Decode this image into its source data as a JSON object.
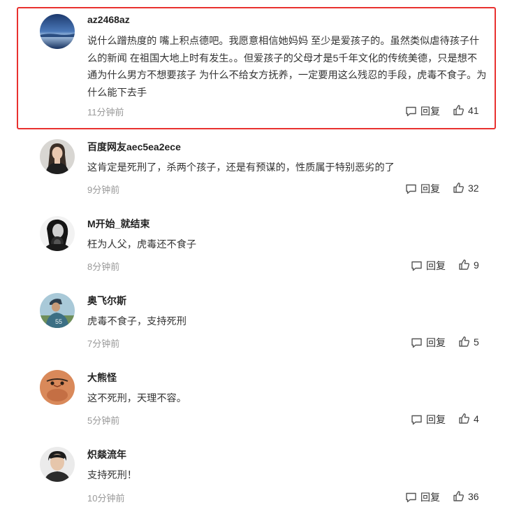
{
  "comments": [
    {
      "username": "az2468az",
      "content": "说什么蹭热度的 嘴上积点德吧。我愿意相信她妈妈 至少是爱孩子的。虽然类似虐待孩子什么的新闻 在祖国大地上时有发生。。但爱孩子的父母才是5千年文化的传统美德，只是想不通为什么男方不想要孩子 为什么不给女方抚养，一定要用这么残忍的手段，虎毒不食子。为什么能下去手",
      "time": "11分钟前",
      "reply_label": "回复",
      "likes": "41",
      "highlighted": true
    },
    {
      "username": "百度网友aec5ea2ece",
      "content": "这肯定是死刑了，杀两个孩子，还是有预谋的，性质属于特别恶劣的了",
      "time": "9分钟前",
      "reply_label": "回复",
      "likes": "32"
    },
    {
      "username": "M开始_就结束",
      "content": "枉为人父，虎毒还不食子",
      "time": "8分钟前",
      "reply_label": "回复",
      "likes": "9"
    },
    {
      "username": "奥飞尔斯",
      "content": "虎毒不食子，支持死刑",
      "time": "7分钟前",
      "reply_label": "回复",
      "likes": "5"
    },
    {
      "username": "大熊怪",
      "content": "这不死刑，天理不容。",
      "time": "5分钟前",
      "reply_label": "回复",
      "likes": "4"
    },
    {
      "username": "炽燚流年",
      "content": "支持死刑！",
      "time": "10分钟前",
      "reply_label": "回复",
      "likes": "36"
    }
  ],
  "colors": {
    "highlight_border": "#e8312f",
    "time_text": "#999999",
    "username_text": "#222222"
  },
  "icons": {
    "reply": "comment-bubble-icon",
    "like": "thumbs-up-icon"
  }
}
